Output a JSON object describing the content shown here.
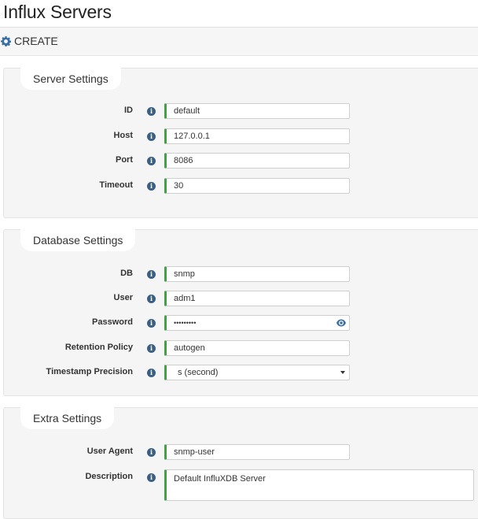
{
  "page": {
    "title": "Influx Servers"
  },
  "toolbar": {
    "create_label": "CREATE"
  },
  "server": {
    "title": "Server Settings",
    "id_label": "ID",
    "id_value": "default",
    "host_label": "Host",
    "host_value": "127.0.0.1",
    "port_label": "Port",
    "port_value": "8086",
    "timeout_label": "Timeout",
    "timeout_value": "30"
  },
  "database": {
    "title": "Database Settings",
    "db_label": "DB",
    "db_value": "snmp",
    "user_label": "User",
    "user_value": "adm1",
    "password_label": "Password",
    "password_value": "•••••••••",
    "retention_label": "Retention Policy",
    "retention_value": "autogen",
    "precision_label": "Timestamp Precision",
    "precision_value": "s (second)"
  },
  "extra": {
    "title": "Extra Settings",
    "agent_label": "User Agent",
    "agent_value": "snmp-user",
    "description_label": "Description",
    "description_value": "Default InfluXDB Server"
  },
  "icons": {
    "create": "gear-icon",
    "info": "info-icon",
    "reveal": "eye-icon",
    "select": "caret-down-icon"
  },
  "colors": {
    "valid_border": "#43a047",
    "info_icon": "#3a5f85",
    "panel_bg": "#f5f5f5"
  }
}
